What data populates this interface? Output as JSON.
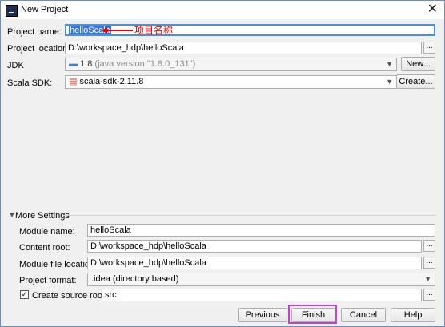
{
  "window": {
    "title": "New Project"
  },
  "project": {
    "name_label": "Project name:",
    "name_value": "helloScala",
    "annotation": "项目名称",
    "location_label": "Project location:",
    "location_value": "D:\\workspace_hdp\\helloScala",
    "jdk_label": "JDK",
    "jdk_version": "1.8",
    "jdk_detail": "(java version \"1.8.0_131\")",
    "jdk_new_button": "New...",
    "scala_label": "Scala SDK:",
    "scala_value": "scala-sdk-2.11.8",
    "scala_create_button": "Create..."
  },
  "more": {
    "header": "More Settings",
    "module_name_label": "Module name:",
    "module_name_value": "helloScala",
    "content_root_label": "Content root:",
    "content_root_value": "D:\\workspace_hdp\\helloScala",
    "module_file_label": "Module file location:",
    "module_file_value": "D:\\workspace_hdp\\helloScala",
    "format_label": "Project format:",
    "format_value": ".idea (directory based)",
    "source_root_label": "Create source root:",
    "source_root_value": "src",
    "browse_label": "..."
  },
  "footer": {
    "previous": "Previous",
    "finish": "Finish",
    "cancel": "Cancel",
    "help": "Help"
  },
  "colors": {
    "accent": "#3875d7",
    "annotation": "#e00000",
    "highlight": "#c040d8"
  }
}
